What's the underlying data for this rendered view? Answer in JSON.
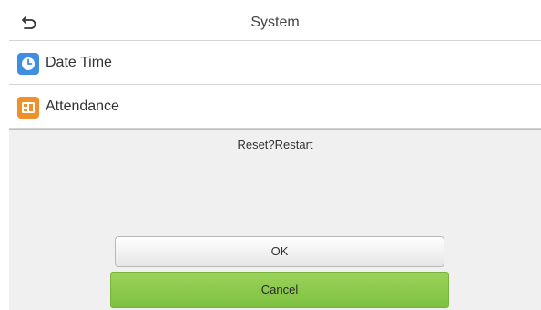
{
  "header": {
    "back_icon": "back-arrow-icon",
    "title": "System"
  },
  "menu": {
    "items": [
      {
        "label": "Date Time",
        "icon": "clock-icon",
        "icon_color": "#3e8fe0"
      },
      {
        "label": "Attendance",
        "icon": "attendance-icon",
        "icon_color": "#f0902a"
      }
    ]
  },
  "dialog": {
    "message": "Reset?Restart",
    "ok_label": "OK",
    "cancel_label": "Cancel",
    "cancel_color": "#8cc84b"
  }
}
